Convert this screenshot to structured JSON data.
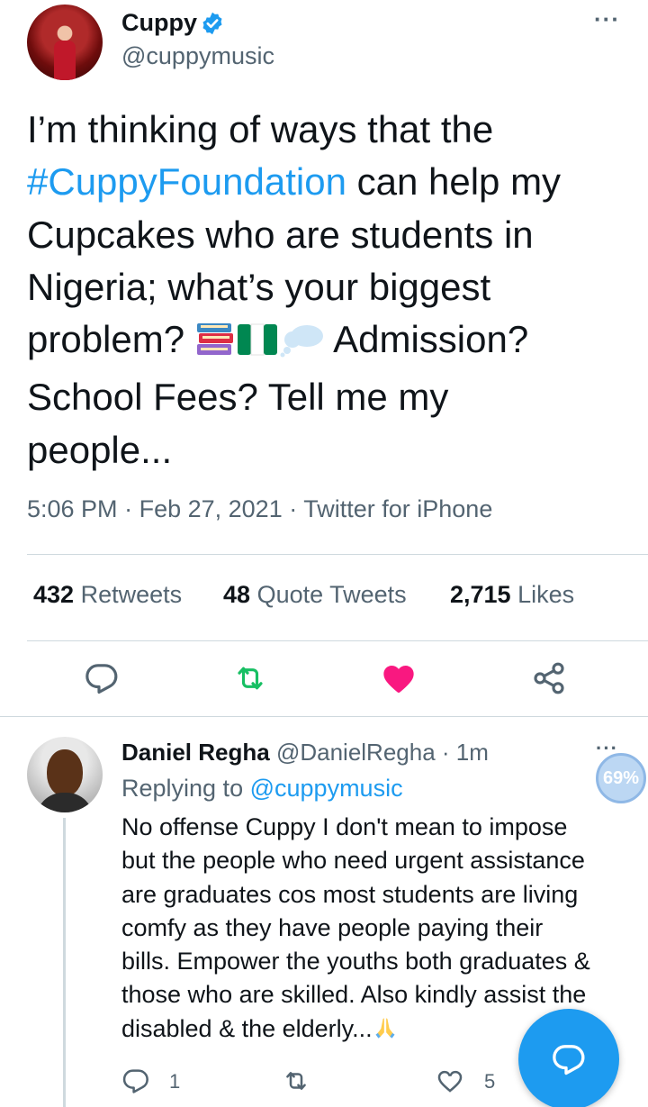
{
  "tweet": {
    "author_name": "Cuppy",
    "author_handle": "@cuppymusic",
    "more_icon": "more-horizontal-icon",
    "text_line1": "I’m thinking of ways that the",
    "hashtag": "#CuppyFoundation",
    "text_after_hashtag": " can help my",
    "text_line3": "Cupcakes who are students in",
    "text_line4": "Nigeria; what’s your biggest",
    "text_line5_before": "problem? ",
    "emojis": [
      "books-emoji",
      "nigeria-flag-emoji",
      "thought-balloon-emoji"
    ],
    "text_line5_after": " Admission?",
    "text_line6": "School Fees? Tell me my",
    "text_line7": "people...",
    "time": "5:06 PM",
    "date": "Feb 27, 2021",
    "source": "Twitter for iPhone",
    "stats": {
      "retweets_count": "432",
      "retweets_label": "Retweets",
      "quotes_count": "48",
      "quotes_label": "Quote Tweets",
      "likes_count": "2,715",
      "likes_label": "Likes"
    },
    "actions": [
      "reply-icon",
      "retweet-icon",
      "like-icon",
      "share-icon"
    ],
    "colors": {
      "retweet": "#17bf63",
      "like": "#f91880",
      "action": "#536471",
      "accent": "#1d9bf0"
    }
  },
  "reply": {
    "author_name": "Daniel Regha",
    "author_handle": "@DanielRegha",
    "time": "1m",
    "replying_to_label": "Replying to",
    "replying_to_mention": "@cuppymusic",
    "badge": "69%",
    "lines": [
      "No offense Cuppy I don't mean to impose",
      "but the people who need urgent assistance",
      "are graduates cos most students are living",
      "comfy as they have people paying their",
      "bills. Empower the youths both graduates &",
      "those who are skilled. Also kindly assist the",
      "disabled & the elderly..."
    ],
    "end_emoji": "folded-hands-emoji",
    "reply_count": "1",
    "like_count": "5"
  },
  "fab": {
    "icon": "compose-reply-icon"
  }
}
